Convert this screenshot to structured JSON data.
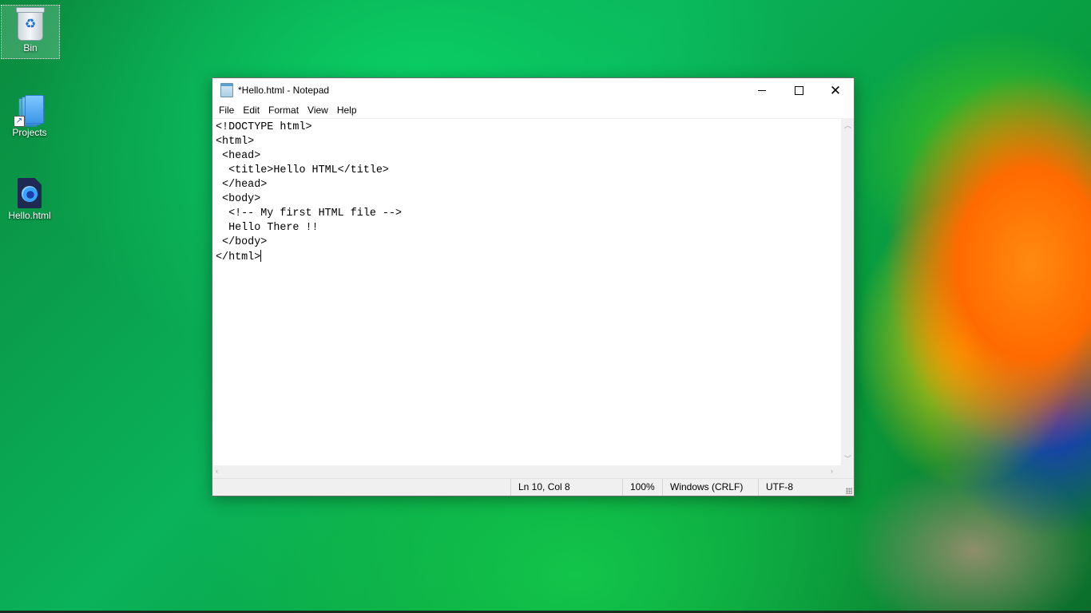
{
  "desktop": {
    "icons": [
      {
        "label": "Bin",
        "icon": "recycle-bin-icon"
      },
      {
        "label": "Projects",
        "icon": "folder-shortcut-icon"
      },
      {
        "label": "Hello.html",
        "icon": "firefox-html-file-icon"
      }
    ]
  },
  "window": {
    "title": "*Hello.html - Notepad",
    "app_icon": "notepad-icon",
    "controls": {
      "minimize": "minimize-icon",
      "maximize": "maximize-icon",
      "close": "close-icon"
    },
    "menu": [
      "File",
      "Edit",
      "Format",
      "View",
      "Help"
    ],
    "editor": {
      "lines": [
        "<!DOCTYPE html>",
        "<html>",
        " <head>",
        "  <title>Hello HTML</title>",
        " </head>",
        " <body>",
        "  <!-- My first HTML file -->",
        "  Hello There !!",
        " </body>",
        "</html>"
      ]
    },
    "status": {
      "position": "Ln 10, Col 8",
      "zoom": "100%",
      "line_ending": "Windows (CRLF)",
      "encoding": "UTF-8"
    }
  }
}
